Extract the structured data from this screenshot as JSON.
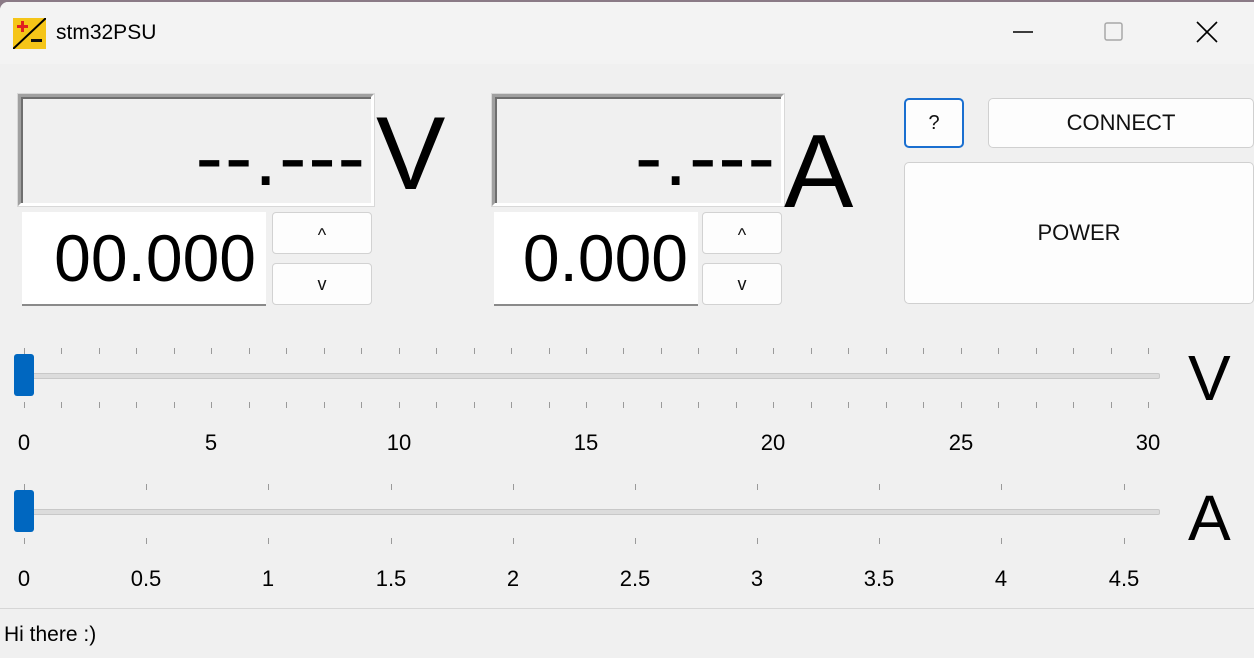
{
  "window": {
    "title": "stm32PSU"
  },
  "voltage": {
    "display": "--.---",
    "unit": "V",
    "setpoint": "00.000",
    "up_label": "^",
    "down_label": "v"
  },
  "current": {
    "display": "-.---",
    "unit": "A",
    "setpoint": "0.000",
    "up_label": "^",
    "down_label": "v"
  },
  "buttons": {
    "help_label": "?",
    "connect_label": "CONNECT",
    "power_label": "POWER"
  },
  "voltage_slider": {
    "unit": "V",
    "min": 0,
    "max": 30,
    "value": 0,
    "tick_labels": [
      "0",
      "5",
      "10",
      "15",
      "20",
      "25",
      "30"
    ]
  },
  "current_slider": {
    "unit": "A",
    "min": 0,
    "max": 4.6,
    "value": 0,
    "tick_labels": [
      "0",
      "0.5",
      "1",
      "1.5",
      "2",
      "2.5",
      "3",
      "3.5",
      "4",
      "4.5"
    ]
  },
  "status_bar": {
    "text": "Hi there :)"
  },
  "colors": {
    "accent": "#0067c0",
    "window_bg": "#f0f0f0",
    "icon_bg": "#f5c518",
    "icon_plus": "#e02020"
  }
}
